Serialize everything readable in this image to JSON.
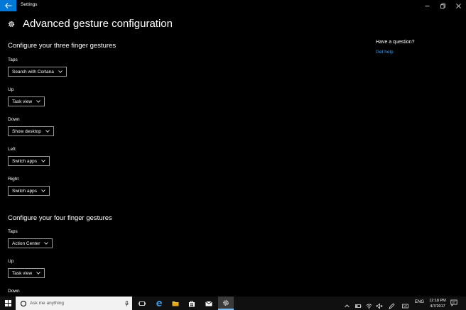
{
  "window": {
    "title": "Settings"
  },
  "page": {
    "title": "Advanced gesture configuration"
  },
  "three_finger": {
    "heading": "Configure your three finger gestures",
    "fields": [
      {
        "label": "Taps",
        "value": "Search with Cortana"
      },
      {
        "label": "Up",
        "value": "Task view"
      },
      {
        "label": "Down",
        "value": "Show desktop"
      },
      {
        "label": "Left",
        "value": "Switch apps"
      },
      {
        "label": "Right",
        "value": "Switch apps"
      }
    ]
  },
  "four_finger": {
    "heading": "Configure your four finger gestures",
    "fields": [
      {
        "label": "Taps",
        "value": "Action Center"
      },
      {
        "label": "Up",
        "value": "Task view"
      },
      {
        "label": "Down",
        "value": ""
      }
    ]
  },
  "help": {
    "title": "Have a question?",
    "link": "Get help"
  },
  "taskbar": {
    "search_placeholder": "Ask me anything",
    "language": "ENG",
    "time": "12:18 PM",
    "date": "4/7/2017"
  },
  "colors": {
    "accent": "#0078d7",
    "link": "#3aa0f3",
    "background": "#000000"
  }
}
